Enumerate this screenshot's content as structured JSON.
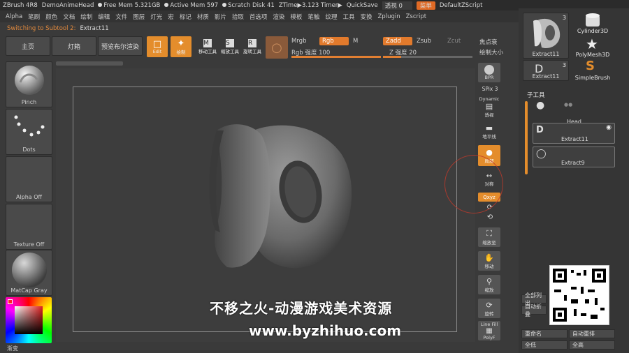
{
  "titlebar": {
    "app": "ZBrush 4R8",
    "doc": "DemoAnimeHead",
    "free_mem": "Free Mem 5.321GB",
    "active_mem": "Active Mem 597",
    "scratch": "Scratch Disk 41",
    "ztime": "ZTime▶3.123 Timer▶",
    "quicksave": "QuickSave",
    "transparency_label": "透视",
    "transparency_value": "0",
    "menu_btn": "菜单",
    "script": "DefaultZScript"
  },
  "menubar": [
    "Alpha",
    "笔刷",
    "颜色",
    "文档",
    "绘制",
    "编辑",
    "文件",
    "图层",
    "灯光",
    "宏",
    "标记",
    "材质",
    "影片",
    "拾取",
    "首选项",
    "渲染",
    "模板",
    "笔触",
    "纹理",
    "工具",
    "变换",
    "Zplugin",
    "Zscript"
  ],
  "infobar": {
    "hint": "Switching to Subtool 2:",
    "subtool": "Extract11"
  },
  "top_buttons": {
    "home": "主页",
    "lightbox": "灯箱",
    "bpr": "预览布尔渲染"
  },
  "draw_modes": {
    "edit": "Edit",
    "draw": "绘制",
    "move": "移动工具",
    "scale": "缩放工具",
    "rotate": "旋转工具",
    "move_letter": "M",
    "scale_letter": "S",
    "rotate_letter": "R"
  },
  "color_controls": {
    "mrgb": "Mrgb",
    "rgb": "Rgb",
    "m": "M",
    "zadd": "Zadd",
    "zsub": "Zsub",
    "zcut": "Zcut",
    "rgb_intensity": "Rgb 强度 100",
    "rgb_intensity_value": 100,
    "z_intensity": "Z 强度 20",
    "z_intensity_value": 20,
    "focal": "焦点衰",
    "draw_size": "绘制大小"
  },
  "left_panel": {
    "brush": "Pinch",
    "stroke": "Dots",
    "alpha": "Alpha Off",
    "texture": "Texture Off",
    "material": "MatCap Gray",
    "gradient": "渐变"
  },
  "right_strip": {
    "bpr": "BPR",
    "spix": "SPix 3",
    "dynamic": "Dynamic",
    "persp": "透视",
    "floor": "地平线",
    "local": "局部",
    "symm": "对称",
    "xyz": "Qxyz",
    "frame": "缩放至",
    "move": "移动",
    "zoom": "缩放",
    "rotate": "旋转",
    "linefill": "Line Fill",
    "polyf": "PolyF"
  },
  "tool_palette": {
    "items": [
      {
        "name": "Extract11",
        "count": "3"
      },
      {
        "name": "Cylinder3D",
        "count": ""
      },
      {
        "name": "PolyMesh3D",
        "count": ""
      },
      {
        "name": "Extract11",
        "count": "3"
      },
      {
        "name": "SimpleBrush",
        "count": ""
      }
    ]
  },
  "subtool": {
    "title": "子工具",
    "rows": [
      "Head",
      "Extract11",
      "Extract9"
    ],
    "list_all": "全部列出",
    "auto_collapse": "自动折叠",
    "rename": "重命名",
    "auto_reorder": "自动重排",
    "all_low": "全低",
    "all_high": "全高"
  },
  "watermark": {
    "line1": "不移之火-动漫游戏美术资源",
    "line2": "www.byzhihuo.com"
  },
  "colors": {
    "accent": "#e48d2c",
    "panel": "#3a3a3a",
    "dark": "#2b2b2b"
  }
}
